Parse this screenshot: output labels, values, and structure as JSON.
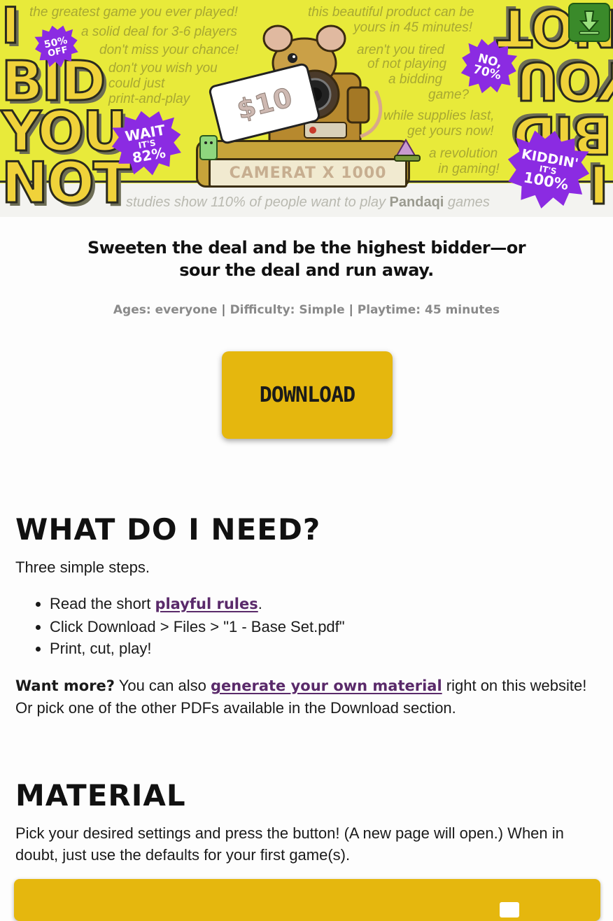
{
  "banner": {
    "title_left": [
      "I",
      "BID",
      "YOU",
      "NOT"
    ],
    "title_right": [
      "NOT",
      "YOU",
      "BID",
      "I"
    ],
    "promo_left": [
      "the greatest game you ever played!",
      "a solid deal for 3-6 players",
      "don't miss your chance!",
      "don't you wish you",
      "could just",
      "print-and-play"
    ],
    "promo_right": [
      "this beautiful product can be",
      "yours in 45 minutes!",
      "aren't you tired",
      "of not playing",
      "a bidding",
      "game?",
      "while supplies last,",
      "get yours now!",
      "a revolution",
      "in gaming!"
    ],
    "bursts": [
      {
        "line1": "50%",
        "line2": "OFF"
      },
      {
        "line1": "WAIT",
        "line2": "IT'S",
        "line3": "82%"
      },
      {
        "line1": "NO,",
        "line2": "70%"
      },
      {
        "line1": "KIDDIN'",
        "line2": "IT'S",
        "line3": "100%"
      }
    ],
    "price_tag": "$10",
    "plaque": "CAMERAT X 1000",
    "tagline_pre": "studies show 110% of people want to play ",
    "tagline_brand": "Pandaqi",
    "tagline_post": " games"
  },
  "subtitle": {
    "line1": "Sweeten the deal and be the highest bidder—or",
    "line2": "sour the deal and run away."
  },
  "meta": {
    "ages": "Ages: everyone",
    "difficulty": "Difficulty: Simple",
    "playtime": "Playtime: 45 minutes",
    "separator": "|"
  },
  "download_label": "DOWNLOAD",
  "need": {
    "heading": "WHAT DO I NEED?",
    "intro": "Three simple steps.",
    "step1_pre": "Read the short ",
    "step1_link": "playful rules",
    "step1_post": ".",
    "step2": "Click Download > Files > \"1 - Base Set.pdf\"",
    "step3": "Print, cut, play!",
    "more_bold": "Want more?",
    "more_pre": " You can also ",
    "more_link": "generate your own material",
    "more_post": " right on this website! Or pick one of the other PDFs available in the Download section."
  },
  "material": {
    "heading": "MATERIAL",
    "text": "Pick your desired settings and press the button! (A new page will open.) When in doubt, just use the defaults for your first game(s)."
  },
  "colors": {
    "accent": "#e5b70e",
    "link": "#5a2a6a",
    "burst": "#8b2be2",
    "banner": "#e8ea3a"
  }
}
